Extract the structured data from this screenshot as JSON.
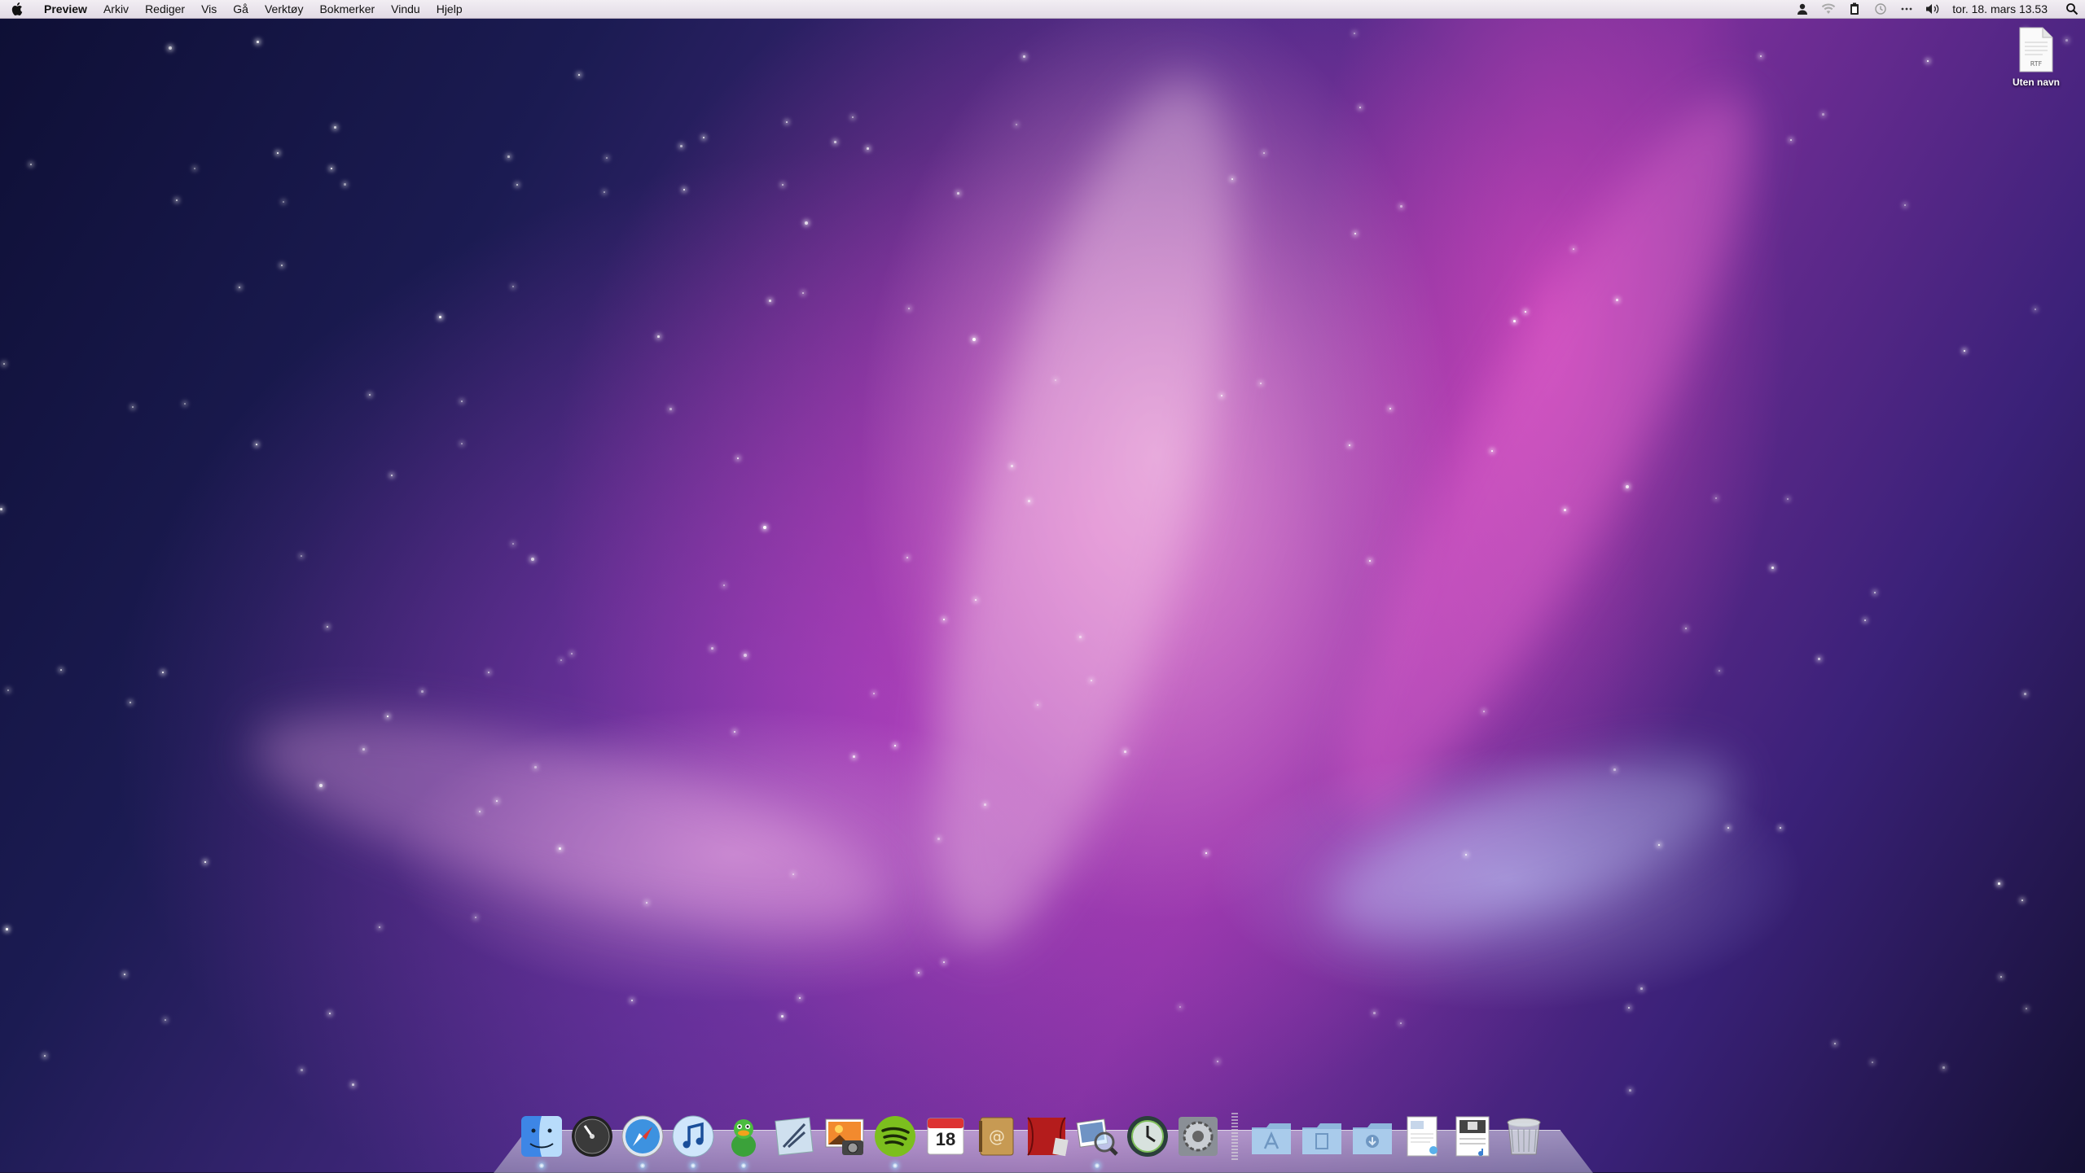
{
  "menubar": {
    "apple_icon": "apple-logo-icon",
    "app_name": "Preview",
    "items": [
      "Arkiv",
      "Rediger",
      "Vis",
      "Gå",
      "Verktøy",
      "Bokmerker",
      "Vindu",
      "Hjelp"
    ],
    "status_icons": [
      "user-icon",
      "wifi-icon",
      "battery-icon",
      "time-machine-icon",
      "bluetooth-icon",
      "volume-icon"
    ],
    "clock": "tor. 18. mars 13.53",
    "search_icon": "spotlight-icon"
  },
  "desktop": {
    "file": {
      "type_label": "RTF",
      "name": "Uten navn",
      "icon": "rtf-document-icon"
    }
  },
  "dock": {
    "apps": [
      {
        "name": "Finder",
        "icon": "finder-icon",
        "running": true
      },
      {
        "name": "Dashboard",
        "icon": "dashboard-icon",
        "running": false
      },
      {
        "name": "Safari",
        "icon": "safari-icon",
        "running": true
      },
      {
        "name": "iTunes",
        "icon": "itunes-icon",
        "running": true
      },
      {
        "name": "Adium",
        "icon": "adium-duck-icon",
        "running": true
      },
      {
        "name": "Mail",
        "icon": "mail-icon",
        "running": false
      },
      {
        "name": "iPhoto",
        "icon": "iphoto-icon",
        "running": false
      },
      {
        "name": "Spotify",
        "icon": "spotify-icon",
        "running": true
      },
      {
        "name": "iCal",
        "icon": "ical-icon",
        "day": "18",
        "running": false
      },
      {
        "name": "Address Book",
        "icon": "address-book-icon",
        "running": false
      },
      {
        "name": "Photo Booth",
        "icon": "photo-booth-icon",
        "running": false
      },
      {
        "name": "Preview",
        "icon": "preview-icon",
        "running": true
      },
      {
        "name": "Time Machine",
        "icon": "time-machine-icon",
        "running": false
      },
      {
        "name": "System Preferences",
        "icon": "system-preferences-icon",
        "running": false
      }
    ],
    "stacks": [
      {
        "name": "Applications",
        "icon": "applications-folder-icon"
      },
      {
        "name": "Documents",
        "icon": "documents-folder-icon"
      },
      {
        "name": "Downloads",
        "icon": "downloads-folder-icon"
      },
      {
        "name": "Document stack",
        "icon": "document-stack-icon"
      },
      {
        "name": "Screenshot stack",
        "icon": "screenshot-stack-icon"
      },
      {
        "name": "Trash",
        "icon": "trash-icon"
      }
    ]
  },
  "colors": {
    "accent_pink": "#d646be",
    "deep_space": "#141033",
    "menubar": "#ece7ee"
  }
}
